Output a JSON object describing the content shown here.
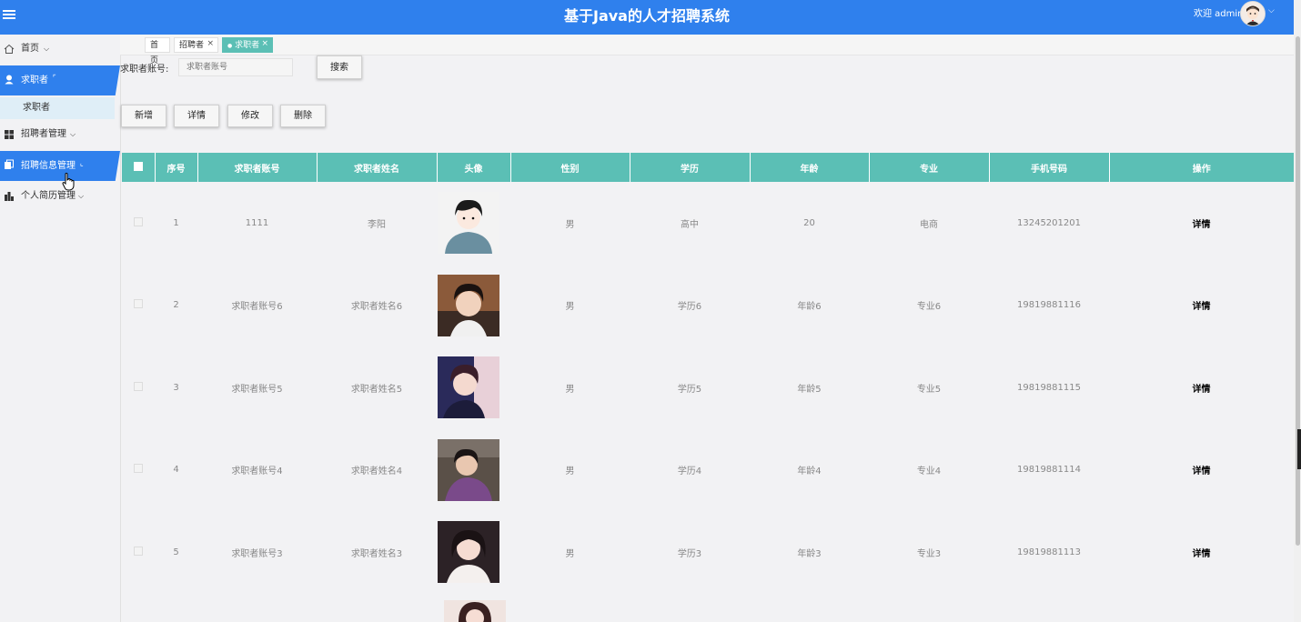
{
  "header": {
    "title": "基于Java的人才招聘系统",
    "welcome": "欢迎 admin"
  },
  "sidebar": {
    "items": [
      {
        "label": "首页",
        "icon": "home-icon"
      },
      {
        "label": "求职者",
        "icon": "user-icon"
      },
      {
        "label": "招聘者管理",
        "icon": "grid-icon"
      },
      {
        "label": "招聘信息管理",
        "icon": "copy-icon"
      },
      {
        "label": "个人简历管理",
        "icon": "chart-icon"
      }
    ],
    "sub_item": "求职者"
  },
  "tabs": [
    {
      "label": "首页"
    },
    {
      "label": "招聘者",
      "close": "×"
    },
    {
      "label": "求职者",
      "close": "×",
      "active": true
    }
  ],
  "search": {
    "label": "求职者账号:",
    "placeholder": "求职者账号",
    "button": "搜索"
  },
  "actions": {
    "add": "新增",
    "detail": "详情",
    "edit": "修改",
    "delete": "删除"
  },
  "table": {
    "headers": [
      "序号",
      "求职者账号",
      "求职者姓名",
      "头像",
      "性别",
      "学历",
      "年龄",
      "专业",
      "手机号码",
      "操作"
    ],
    "rows": [
      {
        "no": "1",
        "account": "1111",
        "name": "李阳",
        "gender": "男",
        "education": "高中",
        "age": "20",
        "major": "电商",
        "phone": "13245201201",
        "action": "详情"
      },
      {
        "no": "2",
        "account": "求职者账号6",
        "name": "求职者姓名6",
        "gender": "男",
        "education": "学历6",
        "age": "年龄6",
        "major": "专业6",
        "phone": "19819881116",
        "action": "详情"
      },
      {
        "no": "3",
        "account": "求职者账号5",
        "name": "求职者姓名5",
        "gender": "男",
        "education": "学历5",
        "age": "年龄5",
        "major": "专业5",
        "phone": "19819881115",
        "action": "详情"
      },
      {
        "no": "4",
        "account": "求职者账号4",
        "name": "求职者姓名4",
        "gender": "男",
        "education": "学历4",
        "age": "年龄4",
        "major": "专业4",
        "phone": "19819881114",
        "action": "详情"
      },
      {
        "no": "5",
        "account": "求职者账号3",
        "name": "求职者姓名3",
        "gender": "男",
        "education": "学历3",
        "age": "年龄3",
        "major": "专业3",
        "phone": "19819881113",
        "action": "详情"
      }
    ]
  },
  "colors": {
    "header": "#2f80ed",
    "accent": "#5bbfb5",
    "active_nav": "#2f80ed"
  }
}
